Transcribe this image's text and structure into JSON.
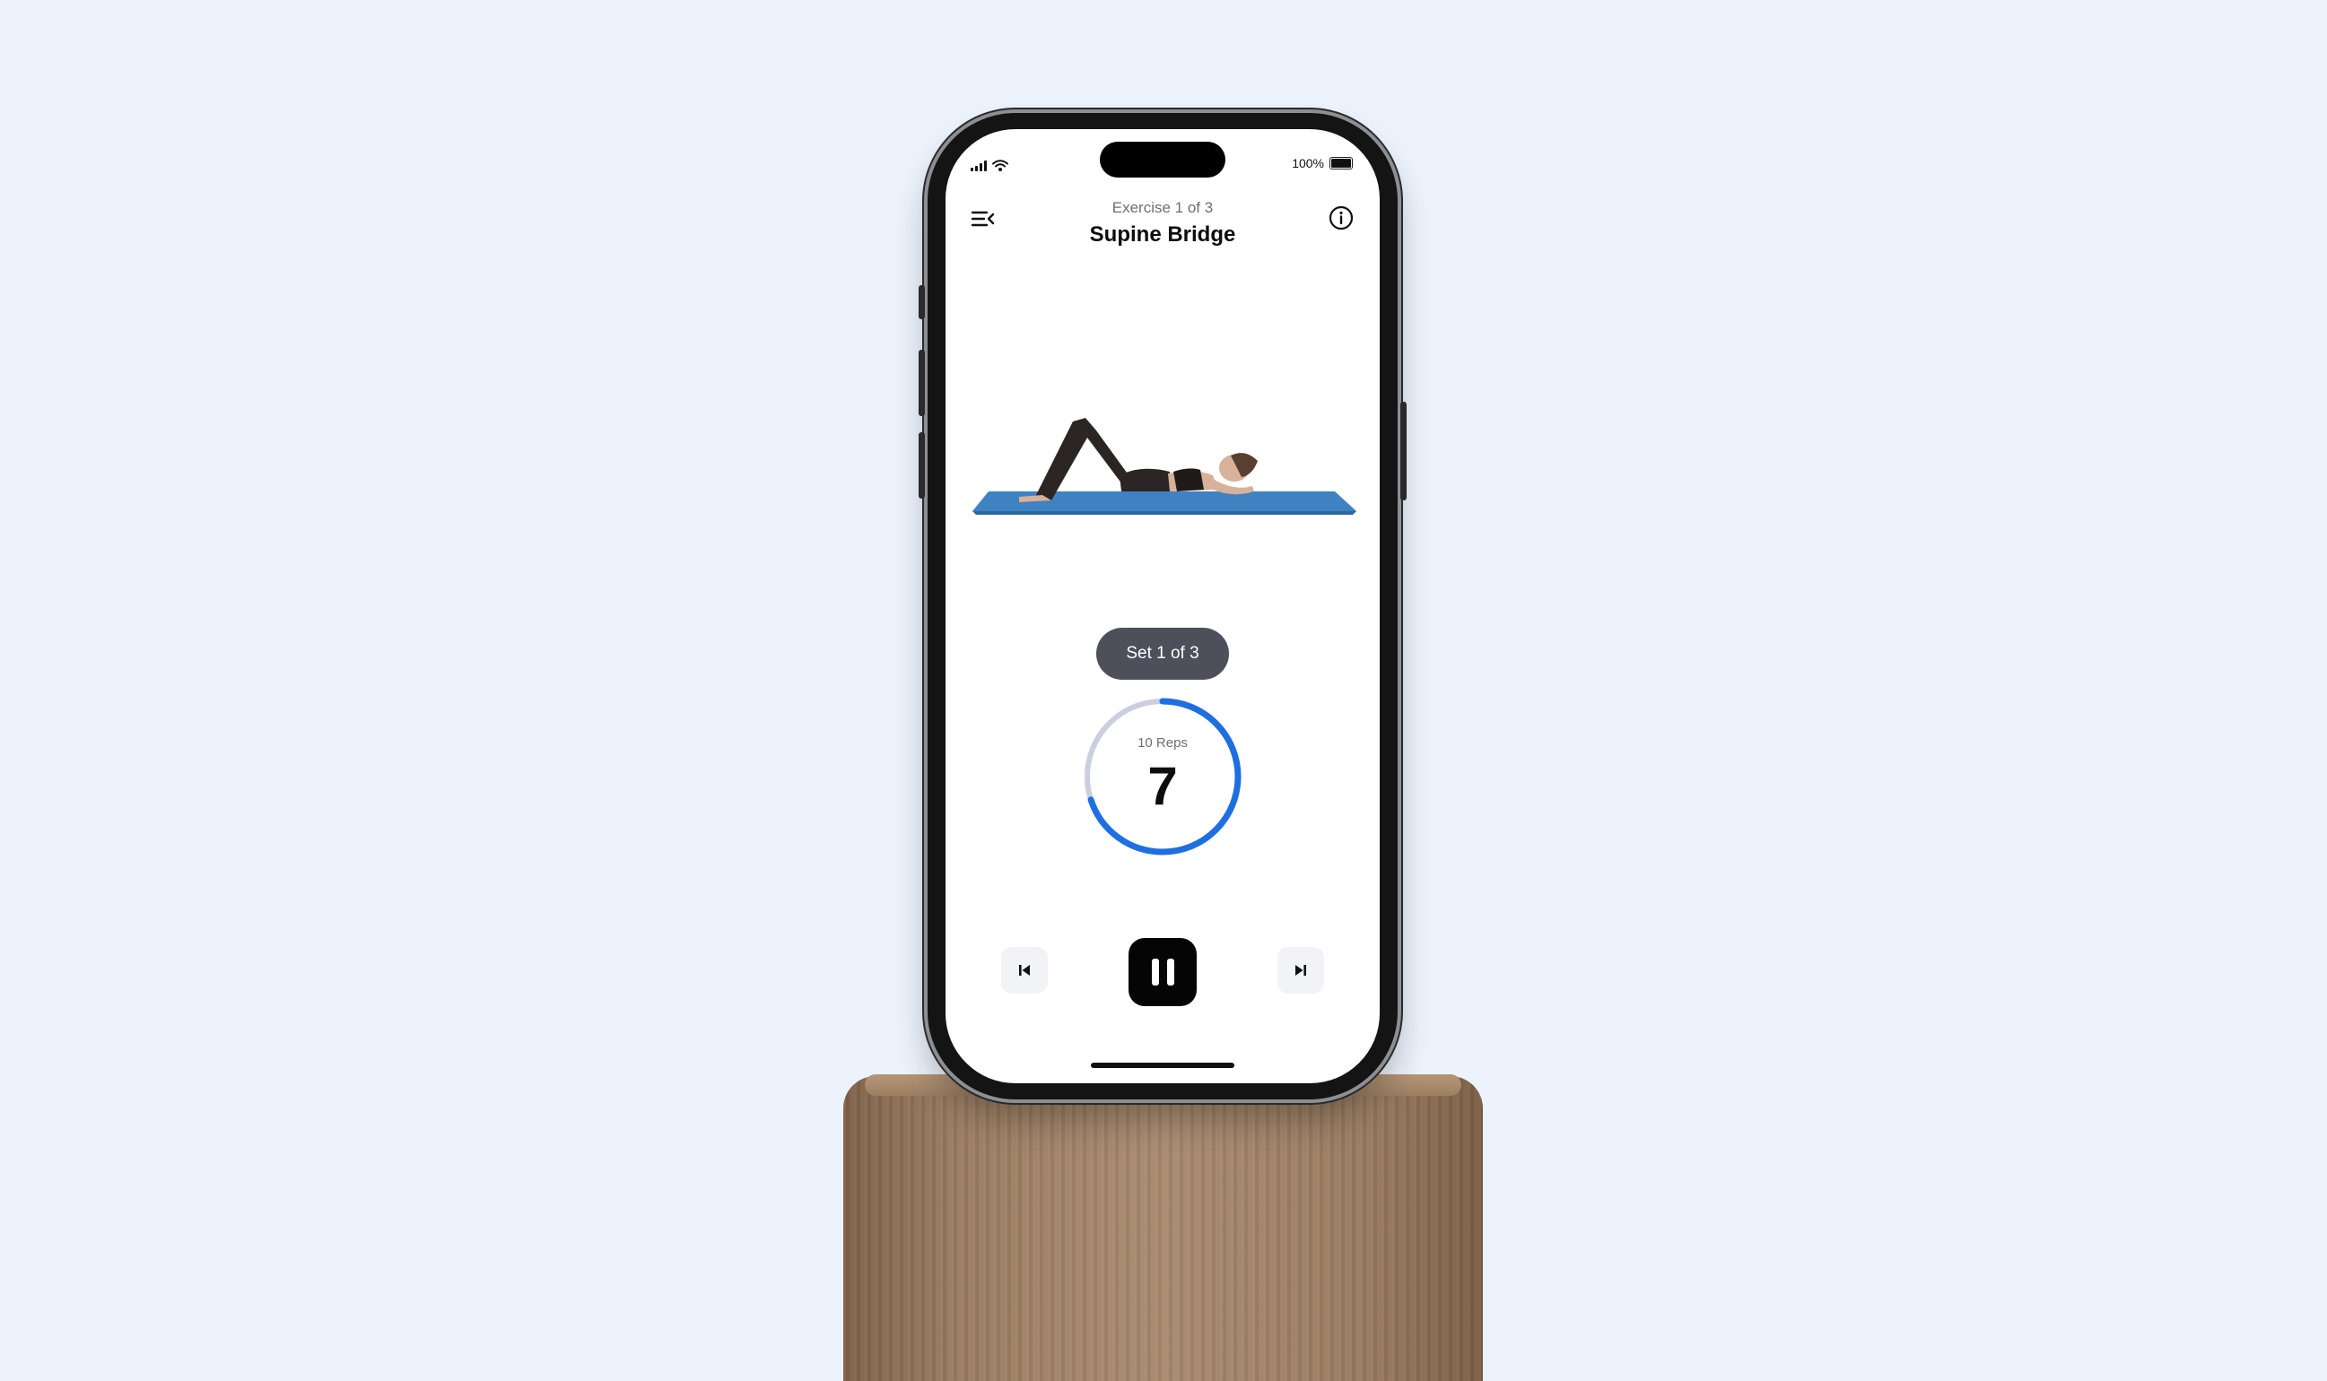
{
  "colors": {
    "background": "#edf3fd",
    "accent": "#1e6fe0",
    "ring_track": "#c9cfdd",
    "pill": "#4d505b"
  },
  "status_bar": {
    "battery_text": "100%",
    "icons": [
      "cellular-signal-icon",
      "wifi-icon",
      "battery-icon"
    ]
  },
  "header": {
    "exercise_counter": "Exercise 1 of 3",
    "exercise_title": "Supine Bridge",
    "menu_icon": "menu-collapse-icon",
    "info_icon": "info-icon"
  },
  "workout": {
    "set_label": "Set 1 of 3",
    "reps_label": "10 Reps",
    "reps_count": "7",
    "progress_fraction": 0.7
  },
  "controls": {
    "previous_icon": "skip-previous-icon",
    "pause_icon": "pause-icon",
    "next_icon": "skip-next-icon"
  }
}
